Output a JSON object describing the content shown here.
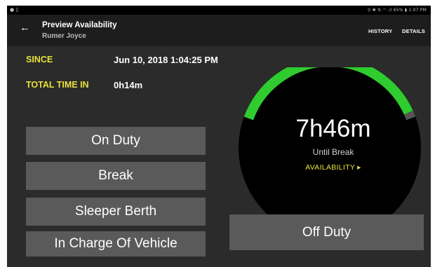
{
  "status_bar": {
    "left_text": "● ▯",
    "right_text": "⚲ ✱ ⇅ ◠ .ıl 65% ▮ 1:07 PM"
  },
  "header": {
    "back_icon": "arrow-left-icon",
    "title": "Preview Availability",
    "subtitle": "Rumer Joyce",
    "history_label": "HISTORY",
    "details_label": "DETAILS"
  },
  "info": {
    "since_label": "SINCE",
    "since_value": "Jun 10, 2018 1:04:25 PM",
    "total_label": "TOTAL TIME IN",
    "total_value": "0h14m"
  },
  "buttons": {
    "on_duty": "On Duty",
    "break": "Break",
    "sleeper_berth": "Sleeper Berth",
    "in_charge": "In Charge Of Vehicle",
    "off_duty": "Off Duty"
  },
  "gauge": {
    "time": "7h46m",
    "sub": "Until Break",
    "link": "AVAILABILITY ▸",
    "fraction_remaining": 0.97,
    "color_remaining": "#2ecc2e",
    "color_used": "#555555"
  },
  "colors": {
    "accent": "#e8e23a",
    "background": "#2b2b2b",
    "button": "#5a5a5a"
  }
}
